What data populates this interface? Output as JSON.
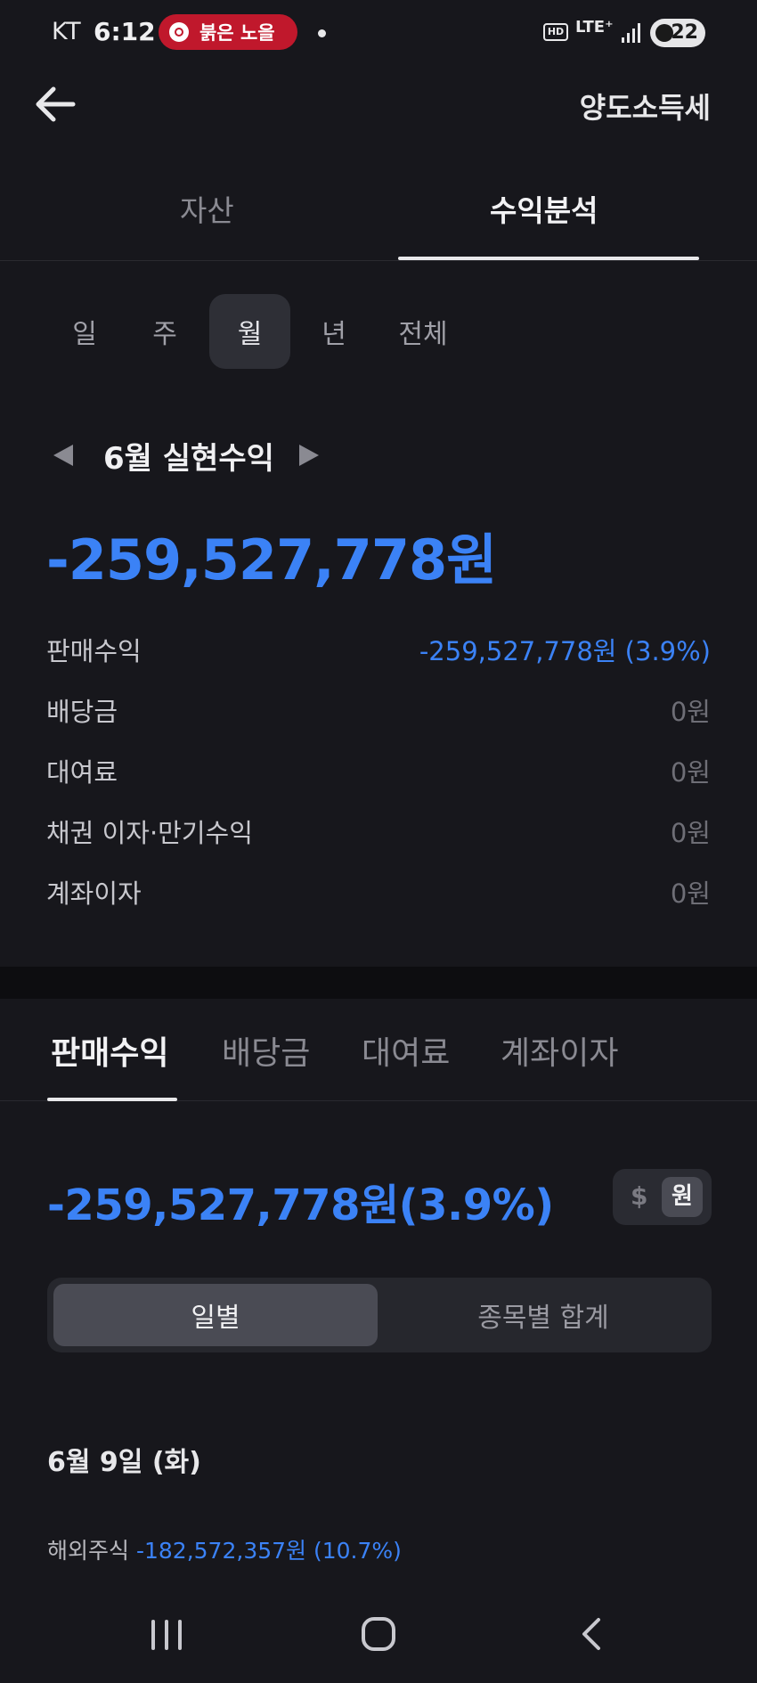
{
  "status_bar": {
    "carrier": "KT",
    "time": "6:12",
    "pill_text": "붉은 노을",
    "network": "LTE⁺",
    "hd": "HD",
    "battery": "22"
  },
  "header": {
    "right_label": "양도소득세"
  },
  "main_tabs": [
    {
      "label": "자산"
    },
    {
      "label": "수익분석"
    }
  ],
  "periods": [
    {
      "label": "일"
    },
    {
      "label": "주"
    },
    {
      "label": "월"
    },
    {
      "label": "년"
    },
    {
      "label": "전체"
    }
  ],
  "summary": {
    "month_label": "6월 실현수익",
    "total": "-259,527,778원",
    "rows": [
      {
        "label": "판매수익",
        "value": "-259,527,778원 (3.9%)"
      },
      {
        "label": "배당금",
        "value": "0원"
      },
      {
        "label": "대여료",
        "value": "0원"
      },
      {
        "label": "채권 이자·만기수익",
        "value": "0원"
      },
      {
        "label": "계좌이자",
        "value": "0원"
      }
    ]
  },
  "sub_tabs": [
    {
      "label": "판매수익"
    },
    {
      "label": "배당금"
    },
    {
      "label": "대여료"
    },
    {
      "label": "계좌이자"
    }
  ],
  "detail": {
    "amount": "-259,527,778원(3.9%)",
    "currency_dollar": "$",
    "currency_won": "원",
    "segment_daily": "일별",
    "segment_by_stock": "종목별 합계",
    "date_heading": "6월 9일 (화)",
    "entry_label": "해외주식",
    "entry_value": "-182,572,357원 (10.7%)"
  },
  "colors": {
    "background": "#17171c",
    "accent_blue": "#3b82f6",
    "pill_red": "#c0182c"
  }
}
